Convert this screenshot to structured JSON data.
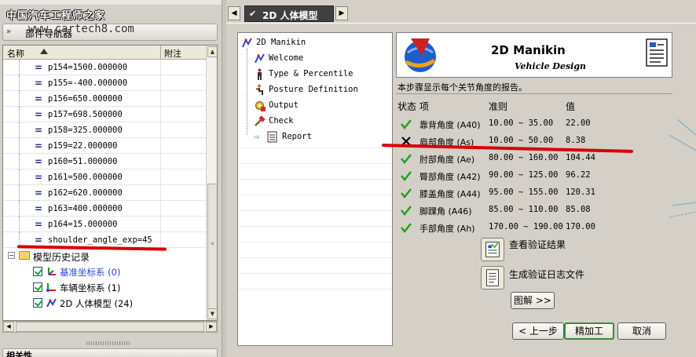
{
  "watermark": {
    "title": "中国汽车工程师之家",
    "site": "www.cartech8.com"
  },
  "nav": {
    "title": "部件导航器",
    "col_name": "名称",
    "col_note": "附注",
    "params": [
      "p154=1500.000000",
      "p155=-400.000000",
      "p156=650.000000",
      "p157=698.500000",
      "p158=325.000000",
      "p159=22.000000",
      "p160=51.000000",
      "p161=500.000000",
      "p162=620.000000",
      "p163=400.000000",
      "p164=15.000000",
      "shoulder_angle_exp=45"
    ],
    "history": {
      "label": "模型历史记录",
      "items": [
        {
          "label": "基准坐标系 (0)",
          "color": "#2b46d8"
        },
        {
          "label": "车辆坐标系 (1)",
          "color": "#000000"
        },
        {
          "label": "2D 人体模型 (24)",
          "color": "#000000"
        }
      ]
    },
    "bottom_label": "相关性"
  },
  "dialog": {
    "tab_label": "2D 人体模型",
    "steps": {
      "root": "2D Manikin",
      "items": [
        "Welcome",
        "Type & Percentile",
        "Posture Definition",
        "Output",
        "Check",
        "Report"
      ]
    },
    "banner": {
      "title": "2D Manikin",
      "subtitle": "Vehicle Design",
      "desc": "本步骤显示每个关节角度的报告。"
    },
    "table": {
      "headers": [
        "状态",
        "项",
        "准则",
        "值"
      ],
      "rows": [
        {
          "status": "pass",
          "item": "靠背角度 (A40)",
          "range": "10.00 ~ 35.00",
          "value": "22.00"
        },
        {
          "status": "fail",
          "item": "肩部角度 (As)",
          "range": "10.00 ~ 50.00",
          "value": "8.38"
        },
        {
          "status": "pass",
          "item": "肘部角度 (Ae)",
          "range": "80.00 ~ 160.00",
          "value": "104.44"
        },
        {
          "status": "pass",
          "item": "臀部角度 (A42)",
          "range": "90.00 ~ 125.00",
          "value": "96.22"
        },
        {
          "status": "pass",
          "item": "膝盖角度 (A44)",
          "range": "95.00 ~ 155.00",
          "value": "120.31"
        },
        {
          "status": "pass",
          "item": "脚踝角 (A46)",
          "range": "85.00 ~ 110.00",
          "value": "85.08"
        },
        {
          "status": "pass",
          "item": "手部角度 (Ah)",
          "range": "170.00 ~ 190.00",
          "value": "170.00"
        }
      ]
    },
    "actions": {
      "view_result": "查看验证结果",
      "gen_log": "生成验证日志文件"
    },
    "buttons": {
      "legend": "图解 >>",
      "prev": "< 上一步",
      "finish": "精加工",
      "cancel": "取消"
    }
  },
  "colors": {
    "highlight_red": "#d80000",
    "pass_green": "#21a121",
    "tab_dark": "#404040"
  }
}
